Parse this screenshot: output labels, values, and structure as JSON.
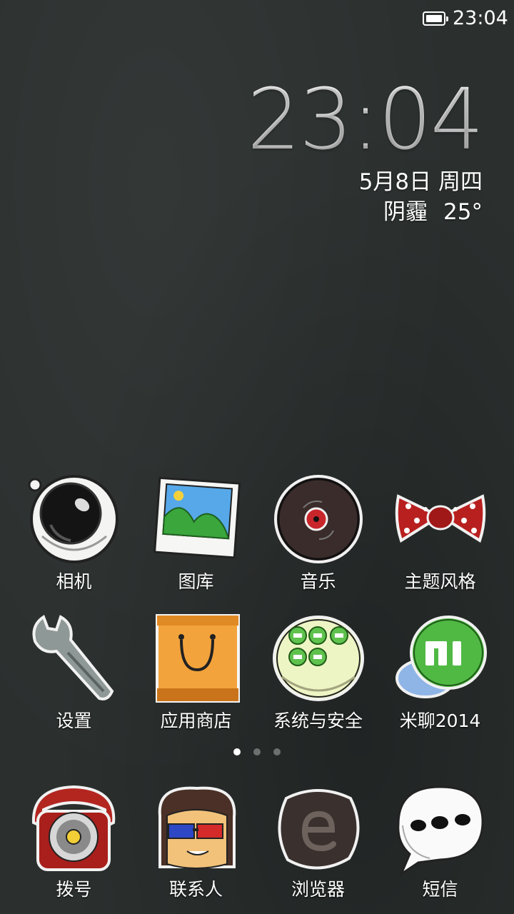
{
  "status_bar": {
    "time": "23:04",
    "battery_level": 1.0
  },
  "clock_widget": {
    "time": "23:04",
    "date": "5月8日 周四",
    "weather_condition": "阴霾",
    "temperature": "25°"
  },
  "apps": [
    {
      "label": "相机",
      "icon": "camera-icon"
    },
    {
      "label": "图库",
      "icon": "gallery-icon"
    },
    {
      "label": "音乐",
      "icon": "music-icon"
    },
    {
      "label": "主题风格",
      "icon": "themes-icon"
    },
    {
      "label": "设置",
      "icon": "settings-wrench-icon"
    },
    {
      "label": "应用商店",
      "icon": "app-store-bag-icon"
    },
    {
      "label": "系统与安全",
      "icon": "security-icon"
    },
    {
      "label": "米聊2014",
      "icon": "miliao-icon"
    }
  ],
  "page_indicator": {
    "count": 3,
    "active": 1
  },
  "dock": [
    {
      "label": "拨号",
      "icon": "phone-dialer-icon"
    },
    {
      "label": "联系人",
      "icon": "contacts-icon"
    },
    {
      "label": "浏览器",
      "icon": "browser-icon"
    },
    {
      "label": "短信",
      "icon": "messages-icon"
    }
  ],
  "colors": {
    "wallpaper": "#2b302f",
    "accent_red": "#b52a24",
    "orange": "#f4a440",
    "green": "#5fbf4c"
  }
}
